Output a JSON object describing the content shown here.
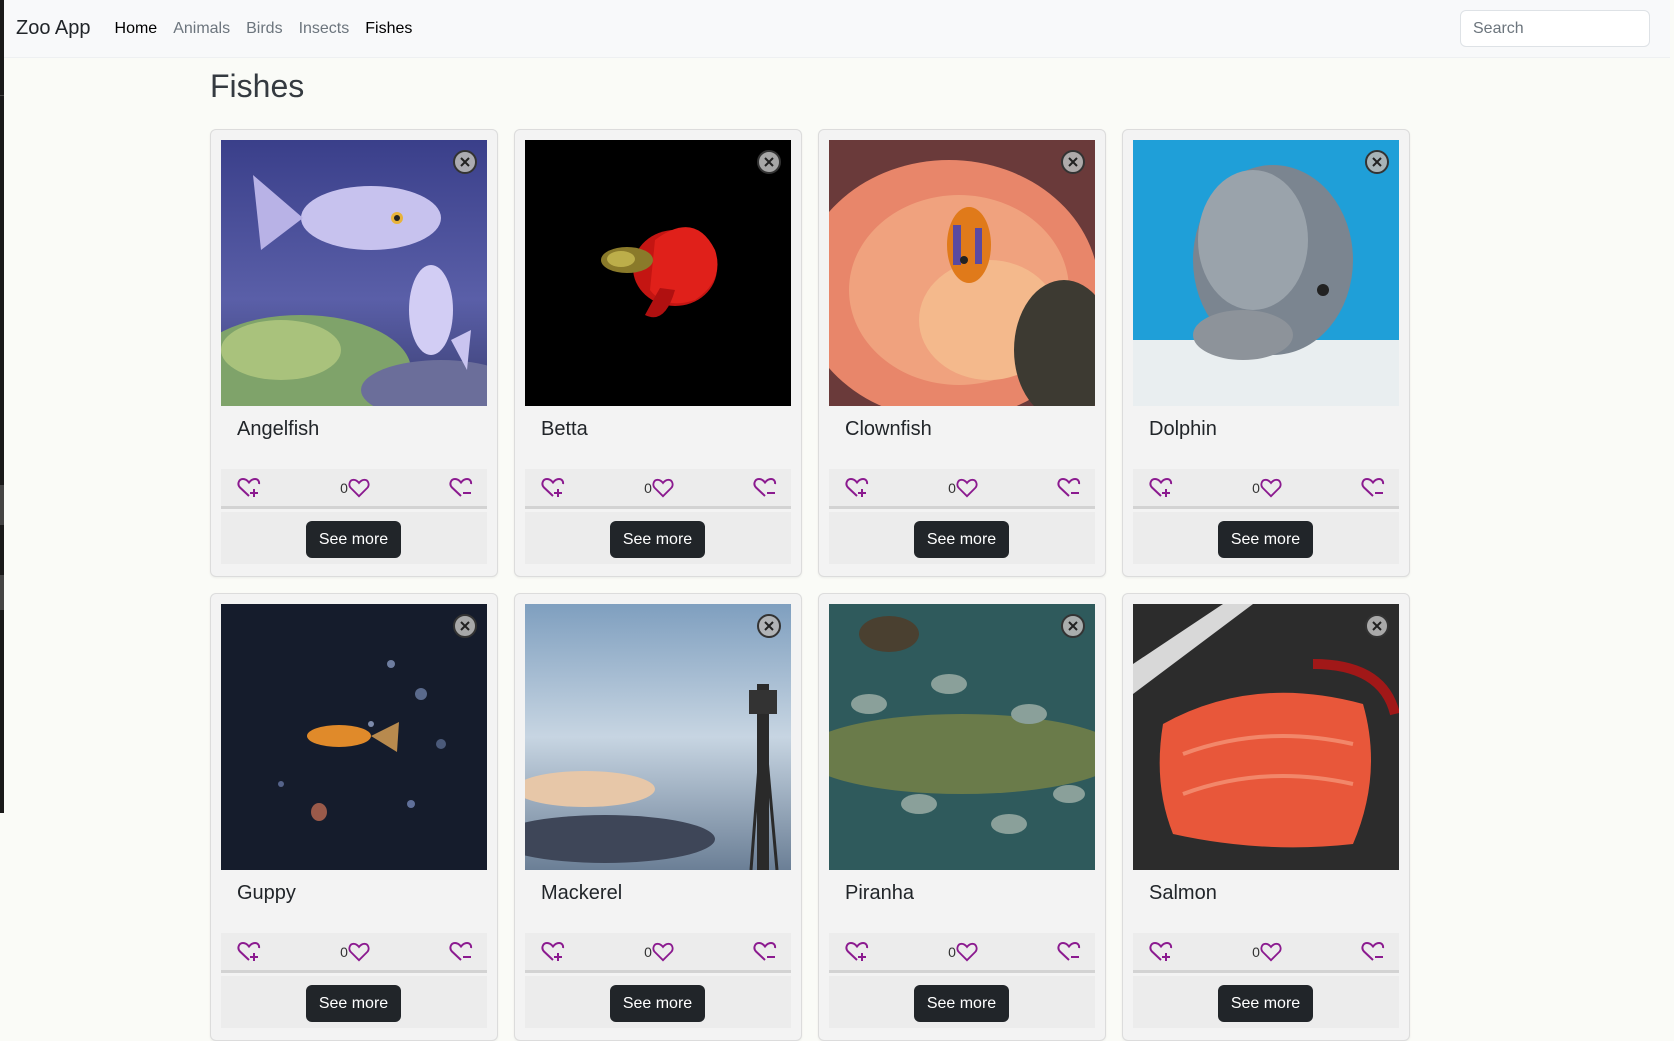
{
  "app": {
    "brand": "Zoo App"
  },
  "nav": {
    "items": [
      {
        "label": "Home",
        "active": false
      },
      {
        "label": "Animals",
        "active": false
      },
      {
        "label": "Birds",
        "active": false
      },
      {
        "label": "Insects",
        "active": false
      },
      {
        "label": "Fishes",
        "active": true
      }
    ]
  },
  "search": {
    "placeholder": "Search",
    "value": ""
  },
  "page": {
    "title": "Fishes"
  },
  "cards": [
    {
      "name": "Angelfish",
      "likes": "0",
      "see_more": "See more"
    },
    {
      "name": "Betta",
      "likes": "0",
      "see_more": "See more"
    },
    {
      "name": "Clownfish",
      "likes": "0",
      "see_more": "See more"
    },
    {
      "name": "Dolphin",
      "likes": "0",
      "see_more": "See more"
    },
    {
      "name": "Guppy",
      "likes": "0",
      "see_more": "See more"
    },
    {
      "name": "Mackerel",
      "likes": "0",
      "see_more": "See more"
    },
    {
      "name": "Piranha",
      "likes": "0",
      "see_more": "See more"
    },
    {
      "name": "Salmon",
      "likes": "0",
      "see_more": "See more"
    }
  ],
  "colors": {
    "heart": "#8b1a8f",
    "button": "#212529",
    "navbar": "#f8f9fa"
  },
  "icons": {
    "close": "close-circle-icon",
    "like_add": "heart-plus-icon",
    "likes": "heart-icon",
    "like_remove": "heart-minus-icon"
  }
}
